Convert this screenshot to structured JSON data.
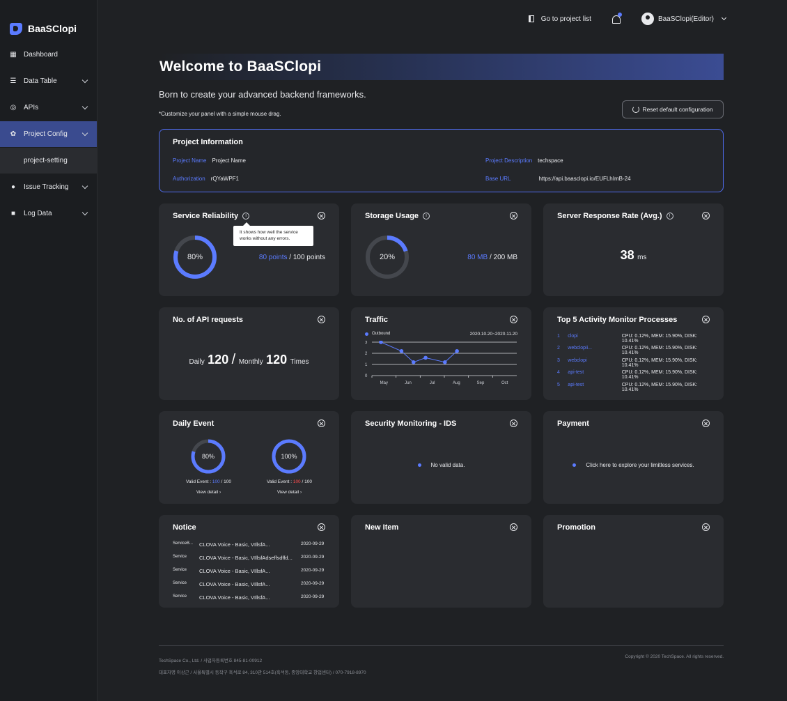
{
  "app": {
    "name": "BaaSClopi"
  },
  "sidebar": {
    "items": [
      {
        "label": "Dashboard",
        "icon": "dashboard-icon"
      },
      {
        "label": "Data Table",
        "icon": "list-icon"
      },
      {
        "label": "APIs",
        "icon": "api-icon"
      },
      {
        "label": "Project Config",
        "icon": "gear-icon"
      },
      {
        "label": "Issue Tracking",
        "icon": "pin-icon"
      },
      {
        "label": "Log Data",
        "icon": "folder-icon"
      }
    ],
    "sub_item": "project-setting"
  },
  "topbar": {
    "goto_label": "Go to project list",
    "user_label": "BaaSClopi(Editor)"
  },
  "welcome": {
    "title": "Welcome to BaaSClopi",
    "subtitle": "Born to create your advanced backend frameworks.",
    "hint": "*Customize your panel with a simple mouse drag.",
    "reset_label": "Reset default configuration"
  },
  "project_info": {
    "title": "Project Information",
    "name_key": "Project Name",
    "name_val": "Project Name",
    "auth_key": "Authorization",
    "auth_val": "rQYaWPF1",
    "desc_key": "Project Description",
    "desc_val": "techspace",
    "url_key": "Base URL",
    "url_val": "https://api.baasclopi.io/EUFLhImB-24"
  },
  "cards": {
    "service": {
      "title": "Service Reliability",
      "tooltip": "It shows how well the service works without any errors.",
      "percent": 80,
      "percent_label": "80%",
      "current": "80 points",
      "sep": "/",
      "total": "100 points"
    },
    "storage": {
      "title": "Storage Usage",
      "percent": 20,
      "percent_label": "20%",
      "current": "80 MB",
      "sep": "/",
      "total": "200 MB"
    },
    "response": {
      "title": "Server Response Rate (Avg.)",
      "value": "38",
      "unit": "ms"
    },
    "api": {
      "title": "No. of API requests",
      "daily_label": "Daily",
      "daily_value": "120",
      "sep": "/",
      "monthly_label": "Monthly",
      "monthly_value": "120",
      "times": "Times"
    },
    "traffic": {
      "title": "Traffic",
      "legend": "Outbound",
      "range": "2020.10.20~2020.11.20"
    },
    "processes": {
      "title": "Top 5 Activity Monitor Processes",
      "rows": [
        {
          "num": "1",
          "name": "clopi",
          "stats": "CPU: 0.12%, MEM: 15.90%, DISK: 10.41%"
        },
        {
          "num": "2",
          "name": "webclopii...",
          "stats": "CPU: 0.12%, MEM: 15.90%, DISK: 10.41%"
        },
        {
          "num": "3",
          "name": "webclopi",
          "stats": "CPU: 0.12%, MEM: 15.90%, DISK: 10.41%"
        },
        {
          "num": "4",
          "name": "api-test",
          "stats": "CPU: 0.12%, MEM: 15.90%, DISK: 10.41%"
        },
        {
          "num": "5",
          "name": "api-test",
          "stats": "CPU: 0.12%, MEM: 15.90%, DISK: 10.41%"
        }
      ]
    },
    "daily_event": {
      "title": "Daily Event",
      "events": [
        {
          "percent": 80,
          "percent_label": "80%",
          "label": "Valid Event :",
          "value": "100",
          "sep": "/",
          "total": "100",
          "link": "View detail ›"
        },
        {
          "percent": 100,
          "percent_label": "100%",
          "label": "Valid Event :",
          "value": "100",
          "sep": "/",
          "total": "100",
          "link": "View detail ›"
        }
      ]
    },
    "security": {
      "title": "Security Monitoring - IDS",
      "message": "No valid data."
    },
    "payment": {
      "title": "Payment",
      "message": "Click here to explore your limitless services."
    },
    "notice": {
      "title": "Notice",
      "rows": [
        {
          "cat": "ServiceB...",
          "text": "CLOVA Voice - Basic, VIllsfA...",
          "date": "2020-09-29"
        },
        {
          "cat": "Service",
          "text": "CLOVA Voice - Basic, VIllsfAdseffsdffd...",
          "date": "2020-09-29"
        },
        {
          "cat": "Service",
          "text": "CLOVA Voice - Basic, VIllsfA...",
          "date": "2020-09-29"
        },
        {
          "cat": "Service",
          "text": "CLOVA Voice - Basic, VIllsfA...",
          "date": "2020-09-29"
        },
        {
          "cat": "Service",
          "text": "CLOVA Voice - Basic, VIllsfA...",
          "date": "2020-09-29"
        }
      ]
    },
    "new_item": {
      "title": "New Item"
    },
    "promotion": {
      "title": "Promotion"
    }
  },
  "footer": {
    "line1": "TechSpace Co., Ltd. / 사업자등록번호 845-81-00912",
    "line2": "대표자명 이상근 / 서울특별시 동작구 흑석로 84, 310관 514호(흑석동, 중앙대학교 창업센터) / 070-7918-8970",
    "copyright": "Copyright © 2020 TechSpace. All rights reserved."
  },
  "colors": {
    "accent": "#5b7bff",
    "active_nav": "#3a4b8f",
    "card_bg": "#2a2c30",
    "alert": "#ff4d4d"
  },
  "chart_data": {
    "type": "line",
    "title": "Traffic",
    "categories": [
      "May",
      "Jun",
      "Jul",
      "Aug",
      "Sep",
      "Oct"
    ],
    "series": [
      {
        "name": "Outbound",
        "x": [
          0.2,
          1.05,
          1.55,
          2.05,
          2.85,
          3.35
        ],
        "values": [
          3.0,
          2.2,
          1.2,
          1.6,
          1.2,
          2.2
        ]
      }
    ],
    "ylim": [
      0,
      3
    ],
    "yticks": [
      0,
      1,
      2,
      3
    ],
    "grid": true,
    "legend": "top-left"
  }
}
